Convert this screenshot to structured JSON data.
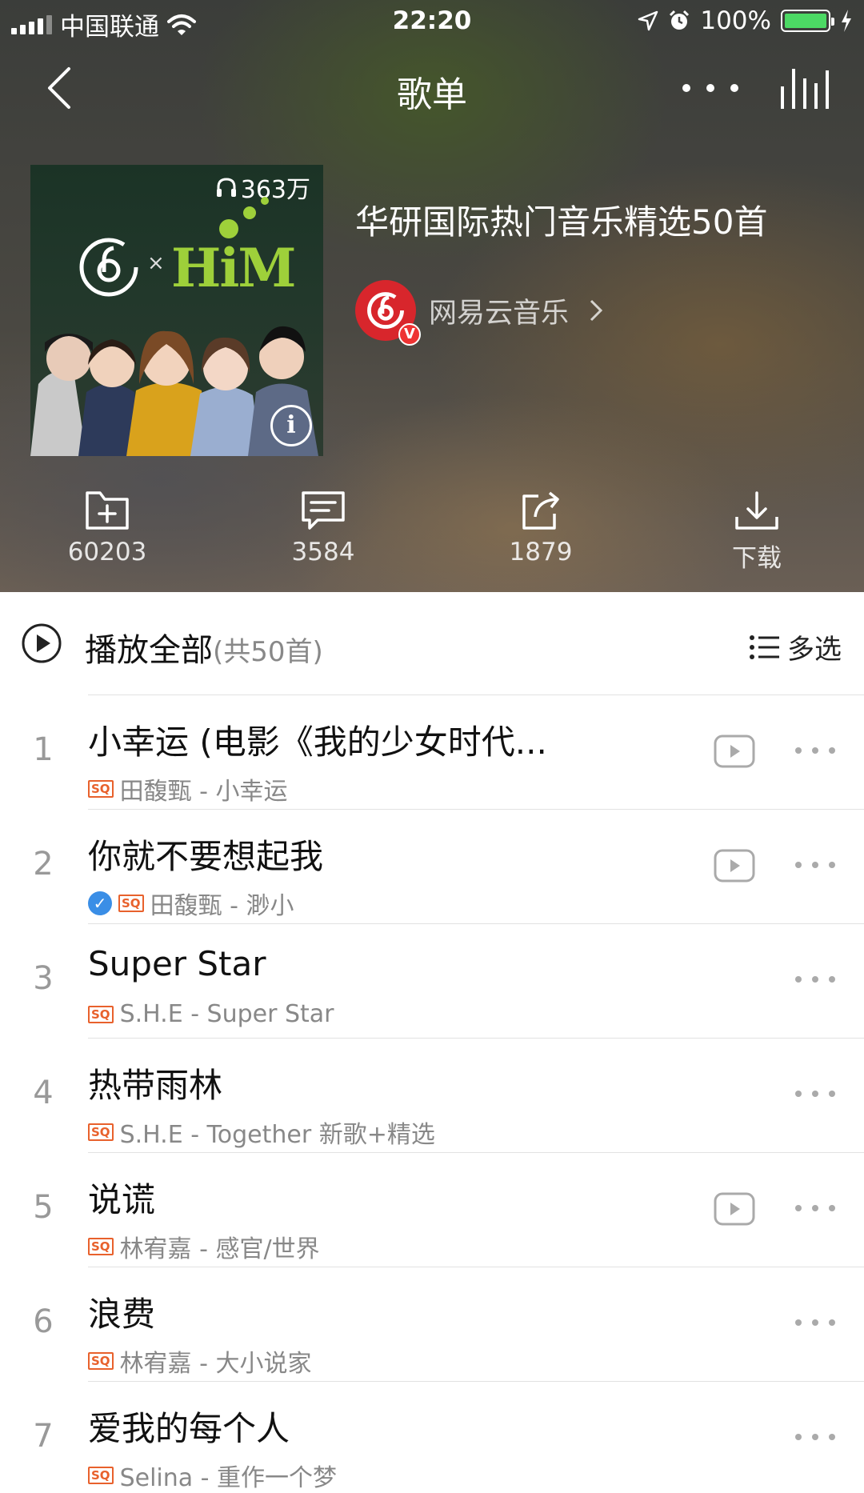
{
  "status_bar": {
    "carrier": "中国联通",
    "time": "22:20",
    "battery": "100%"
  },
  "nav": {
    "title": "歌单"
  },
  "cover": {
    "play_count": "363万",
    "brand": "HiM",
    "brand_x": "×"
  },
  "playlist": {
    "title": "华研国际热门音乐精选50首",
    "creator": "网易云音乐"
  },
  "actions": [
    {
      "icon": "add-folder-icon",
      "label": "60203"
    },
    {
      "icon": "comment-icon",
      "label": "3584"
    },
    {
      "icon": "share-icon",
      "label": "1879"
    },
    {
      "icon": "download-icon",
      "label": "下载"
    }
  ],
  "play_all": {
    "label": "播放全部",
    "count": "(共50首)"
  },
  "multi_select": {
    "label": "多选"
  },
  "songs": [
    {
      "index": "1",
      "title": "小幸运 (电影《我的少女时代...",
      "quality": "SQ",
      "artist_album": "田馥甄 - 小幸运",
      "has_mv": true,
      "downloaded": false
    },
    {
      "index": "2",
      "title": "你就不要想起我",
      "quality": "SQ",
      "artist_album": "田馥甄 - 渺小",
      "has_mv": true,
      "downloaded": true
    },
    {
      "index": "3",
      "title": "Super Star",
      "quality": "SQ",
      "artist_album": "S.H.E - Super Star",
      "has_mv": false,
      "downloaded": false
    },
    {
      "index": "4",
      "title": "热带雨林",
      "quality": "SQ",
      "artist_album": "S.H.E - Together 新歌+精选",
      "has_mv": false,
      "downloaded": false
    },
    {
      "index": "5",
      "title": "说谎",
      "quality": "SQ",
      "artist_album": "林宥嘉 - 感官/世界",
      "has_mv": true,
      "downloaded": false
    },
    {
      "index": "6",
      "title": "浪费",
      "quality": "SQ",
      "artist_album": "林宥嘉 - 大小说家",
      "has_mv": false,
      "downloaded": false
    },
    {
      "index": "7",
      "title": "爱我的每个人",
      "quality": "SQ",
      "artist_album": "Selina - 重作一个梦",
      "has_mv": false,
      "downloaded": false
    }
  ],
  "colors": {
    "accent_red": "#d8262c",
    "sq_orange": "#e8612c",
    "check_blue": "#3a8ee6",
    "him_green": "#9ed03a"
  }
}
